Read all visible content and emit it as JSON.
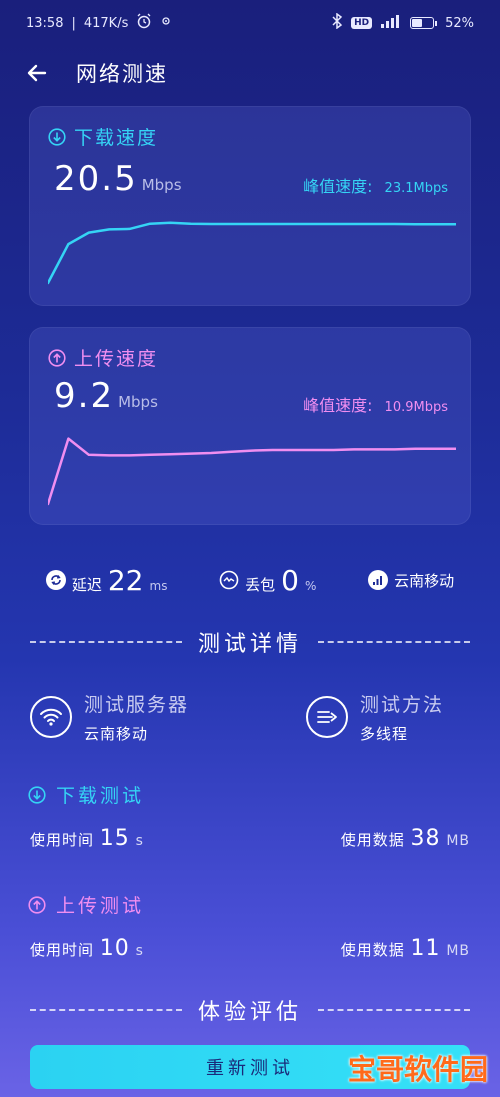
{
  "statusbar": {
    "time": "13:58",
    "separator": "|",
    "net_speed": "417K/s",
    "hd": "HD",
    "battery": "52%",
    "battery_level": 0.52
  },
  "appbar": {
    "title": "网络测速"
  },
  "download_card": {
    "title": "下载速度",
    "value": "20.5",
    "unit": "Mbps",
    "peak_label": "峰值速度:",
    "peak_value": "23.1Mbps",
    "color": "#35d4f5"
  },
  "upload_card": {
    "title": "上传速度",
    "value": "9.2",
    "unit": "Mbps",
    "peak_label": "峰值速度:",
    "peak_value": "10.9Mbps",
    "color": "#f08ef0"
  },
  "metrics": {
    "latency_label": "延迟",
    "latency_value": "22",
    "latency_unit": "ms",
    "loss_label": "丢包",
    "loss_value": "0",
    "loss_unit": "%",
    "carrier": "云南移动"
  },
  "details": {
    "title": "测试详情",
    "server_label": "测试服务器",
    "server_value": "云南移动",
    "method_label": "测试方法",
    "method_value": "多线程"
  },
  "download_test": {
    "title": "下载测试",
    "time_label": "使用时间",
    "time_value": "15",
    "time_unit": "s",
    "data_label": "使用数据",
    "data_value": "38",
    "data_unit": "MB"
  },
  "upload_test": {
    "title": "上传测试",
    "time_label": "使用时间",
    "time_value": "10",
    "time_unit": "s",
    "data_label": "使用数据",
    "data_value": "11",
    "data_unit": "MB"
  },
  "evaluation": {
    "title": "体验评估"
  },
  "retest_button": "重新测试",
  "watermark": "宝哥软件园",
  "icons": {
    "back": "back-arrow-icon",
    "download": "download-circle-icon",
    "upload": "upload-circle-icon",
    "latency": "latency-icon",
    "loss": "packet-loss-icon",
    "carrier": "signal-bars-icon",
    "server": "wifi-icon",
    "method": "multithread-icon"
  },
  "chart_data": [
    {
      "type": "line",
      "series": [
        {
          "values": [
            0,
            13.5,
            17.5,
            18.6,
            18.8,
            20.6,
            20.9,
            20.6,
            20.5,
            20.5,
            20.5,
            20.5,
            20.5,
            20.5,
            20.5,
            20.5,
            20.5,
            20.5,
            20.4,
            20.4,
            20.4
          ]
        }
      ]
    },
    {
      "type": "line",
      "series": [
        {
          "values": [
            0,
            10.9,
            8.2,
            8.1,
            8.1,
            8.2,
            8.3,
            8.4,
            8.5,
            8.7,
            8.9,
            9.0,
            9.0,
            9.0,
            9.0,
            9.1,
            9.1,
            9.1,
            9.2,
            9.2,
            9.2
          ]
        }
      ]
    }
  ]
}
